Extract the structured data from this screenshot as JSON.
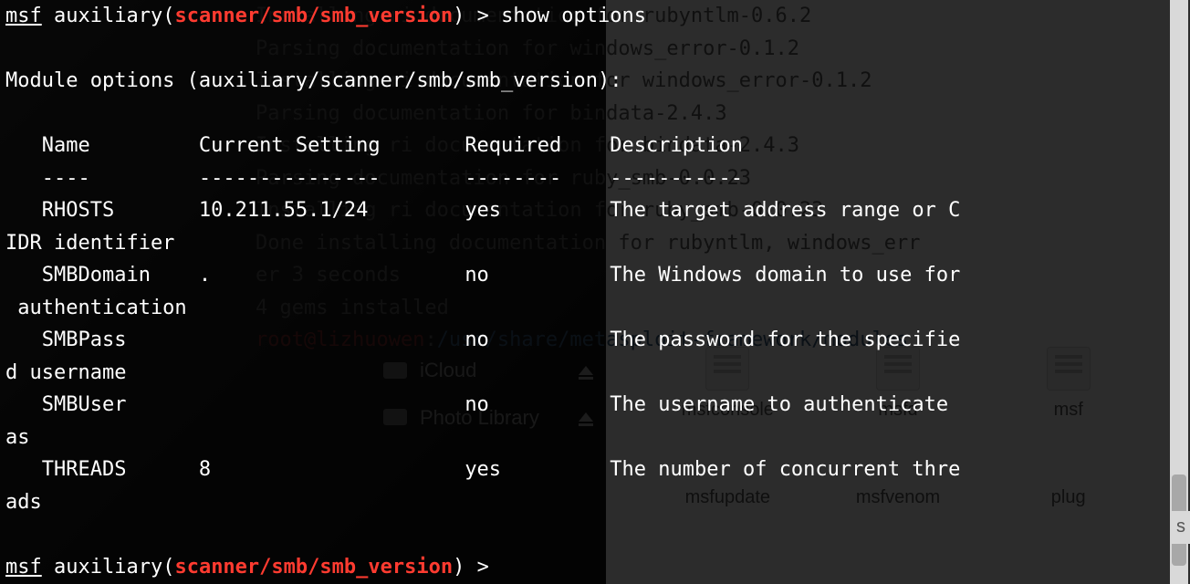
{
  "prompt": {
    "prefix": "msf",
    "label": "auxiliary",
    "module": "scanner/smb/smb_version",
    "caret": ">",
    "command": "show options"
  },
  "module_options_header": "Module options (auxiliary/scanner/smb/smb_version):",
  "table": {
    "headers": [
      "Name",
      "Current Setting",
      "Required",
      "Description"
    ],
    "rows": [
      {
        "name": "RHOSTS",
        "setting": "10.211.55.1/24",
        "required": "yes",
        "desc_l1": "The target address range or C",
        "desc_wrap": "IDR identifier"
      },
      {
        "name": "SMBDomain",
        "setting": ".",
        "required": "no",
        "desc_l1": "The Windows domain to use for",
        "desc_wrap": " authentication"
      },
      {
        "name": "SMBPass",
        "setting": "",
        "required": "no",
        "desc_l1": "The password for the specifie",
        "desc_wrap": "d username"
      },
      {
        "name": "SMBUser",
        "setting": "",
        "required": "no",
        "desc_l1": "The username to authenticate ",
        "desc_wrap": "as"
      },
      {
        "name": "THREADS",
        "setting": "8",
        "required": "yes",
        "desc_l1": "The number of concurrent thre",
        "desc_wrap": "ads"
      }
    ]
  },
  "ghost_lines": [
    "Installing ri documentation for rubyntlm-0.6.2",
    "Parsing documentation for windows_error-0.1.2",
    "Installing ri documentation for windows_error-0.1.2",
    "Parsing documentation for bindata-2.4.3",
    "Installing ri documentation for bindata-2.4.3",
    "Parsing documentation for ruby_smb-0.0.23",
    "Installing ri documentation for ruby_smb-0.0.23",
    "Done installing documentation for rubyntlm, windows_err",
    "er 3 seconds",
    "4 gems installed"
  ],
  "ghost_prompt": {
    "user": "root@lizhuowen",
    "sep": ":",
    "path": "/usr/share/metasploit-framework/modules"
  },
  "bg": {
    "sidebar": [
      {
        "label": "iCloud"
      },
      {
        "label": "Photo Library"
      }
    ],
    "files_row1": [
      "msfconsole",
      "msfd",
      "msf"
    ],
    "files_row2": [
      "msfupdate",
      "msfvenom",
      "plug"
    ],
    "cut_s": "s"
  }
}
